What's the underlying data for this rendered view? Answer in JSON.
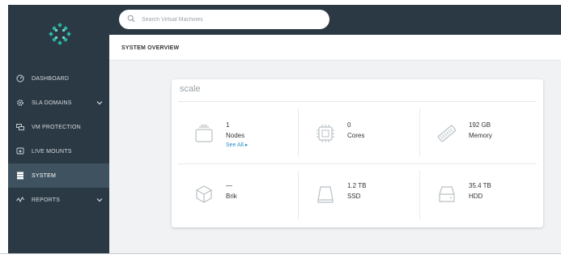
{
  "search": {
    "placeholder": "Search Virtual Machines"
  },
  "sidebar": {
    "items": [
      {
        "label": "DASHBOARD",
        "icon": "dashboard-icon",
        "active": false
      },
      {
        "label": "SLA DOMAINS",
        "icon": "gear-icon",
        "active": false,
        "expandable": true
      },
      {
        "label": "VM PROTECTION",
        "icon": "vm-protection-icon",
        "active": false
      },
      {
        "label": "LIVE MOUNTS",
        "icon": "live-mount-icon",
        "active": false
      },
      {
        "label": "SYSTEM",
        "icon": "system-icon",
        "active": true
      },
      {
        "label": "REPORTS",
        "icon": "reports-icon",
        "active": false,
        "expandable": true
      }
    ]
  },
  "header": {
    "title": "SYSTEM OVERVIEW"
  },
  "card": {
    "title": "scale",
    "stats": {
      "nodes": {
        "value": "1",
        "label": "Nodes",
        "link": "See All ▸"
      },
      "cores": {
        "value": "0",
        "label": "Cores"
      },
      "memory": {
        "value": "192 GB",
        "label": "Memory"
      },
      "brik": {
        "value": "—",
        "label": "Brik"
      },
      "ssd": {
        "value": "1.2 TB",
        "label": "SSD"
      },
      "hdd": {
        "value": "35.4 TB",
        "label": "HDD"
      }
    }
  },
  "colors": {
    "sidebar_bg": "#2b3944",
    "active_item_bg": "#3e5260",
    "link": "#2e8fc9",
    "logo": "#2bb3a3"
  }
}
